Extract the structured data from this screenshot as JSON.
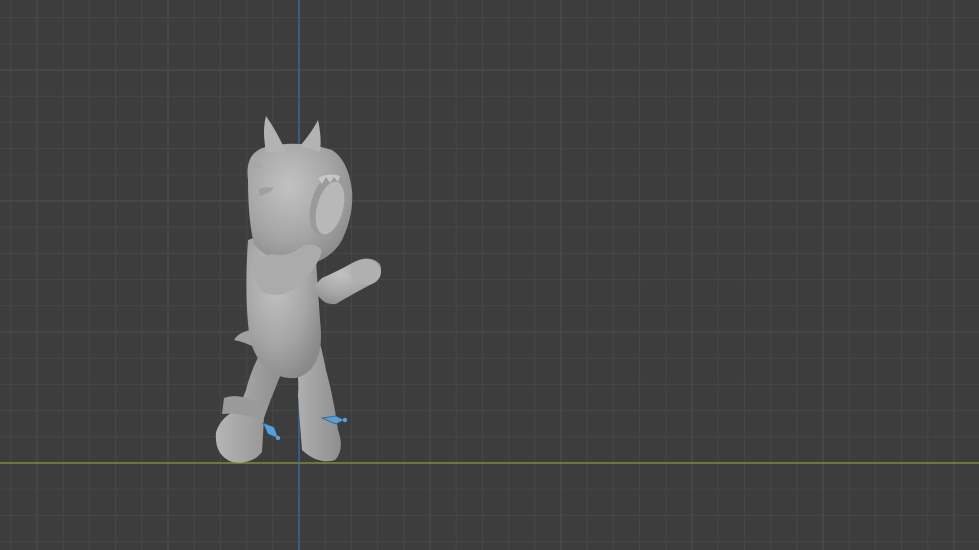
{
  "viewport": {
    "background_color": "#3d3d3d",
    "grid_minor_color": "#474747",
    "grid_major_color": "#4f4f4f",
    "x_axis_color": "#8a9a3c",
    "z_axis_color": "#3f6fae"
  },
  "model": {
    "body_color": "#a7a7a7",
    "shadow_color": "#8c8c8c",
    "highlight_color": "#bdbdbd"
  },
  "bones": {
    "color": "#5aa0d8",
    "outline": "#2e5f85"
  }
}
